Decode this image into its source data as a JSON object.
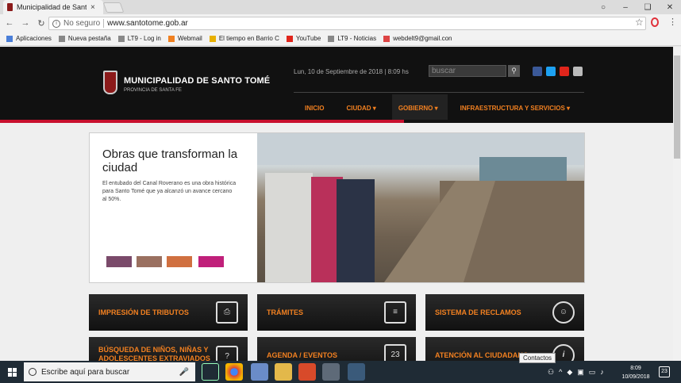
{
  "browser": {
    "tab_title": "Municipalidad de Santo T",
    "address_security": "No seguro",
    "address_url": "www.santotome.gob.ar",
    "window_buttons": [
      "○",
      "–",
      "❑",
      "✕"
    ],
    "bookmarks": [
      {
        "label": "Aplicaciones",
        "color": "#4a7ed8"
      },
      {
        "label": "Nueva pestaña",
        "color": "#888"
      },
      {
        "label": "LT9 - Log in",
        "color": "#888"
      },
      {
        "label": "Webmail",
        "color": "#f08020"
      },
      {
        "label": "El tiempo en Barrio C",
        "color": "#e8b000"
      },
      {
        "label": "YouTube",
        "color": "#e0251b"
      },
      {
        "label": "LT9 - Noticias",
        "color": "#888"
      },
      {
        "label": "webdelt9@gmail.con",
        "color": "#d44"
      }
    ]
  },
  "site": {
    "logo_title": "MUNICIPALIDAD DE SANTO TOMÉ",
    "logo_sub": "PROVINCIA DE SANTA FE",
    "date": "Lun, 10 de Septiembre de 2018 | 8:09 hs",
    "search_placeholder": "buscar",
    "nav": [
      "INICIO",
      "CIUDAD ▾",
      "GOBIERNO ▾",
      "INFRAESTRUCTURA Y SERVICIOS ▾"
    ],
    "slide": {
      "title": "Obras que transforman la ciudad",
      "text": "El entubado del Canal Roverano es una obra histórica para Santo Tomé que ya alcanzó un avance cercano al 50%."
    },
    "tiles": [
      {
        "label": "IMPRESIÓN DE TRIBUTOS",
        "icon": "printer-icon",
        "glyph": "⎙"
      },
      {
        "label": "TRÁMITES",
        "icon": "clipboard-icon",
        "glyph": "≡"
      },
      {
        "label": "SISTEMA DE RECLAMOS",
        "icon": "face-icon",
        "glyph": "☺"
      },
      {
        "label": "BÚSQUEDA DE NIÑOS, NIÑAS Y ADOLESCENTES EXTRAVIADOS",
        "icon": "question-person-icon",
        "glyph": "?"
      },
      {
        "label": "AGENDA / EVENTOS",
        "icon": "calendar-icon",
        "glyph": "23"
      },
      {
        "label": "ATENCIÓN AL CIUDADANO",
        "icon": "info-icon",
        "glyph": "i"
      }
    ]
  },
  "taskbar": {
    "search_placeholder": "Escribe aquí para buscar",
    "contacts_label": "Contactos",
    "clock_time": "8:09",
    "clock_date": "10/09/2018",
    "notif_count": "23"
  }
}
